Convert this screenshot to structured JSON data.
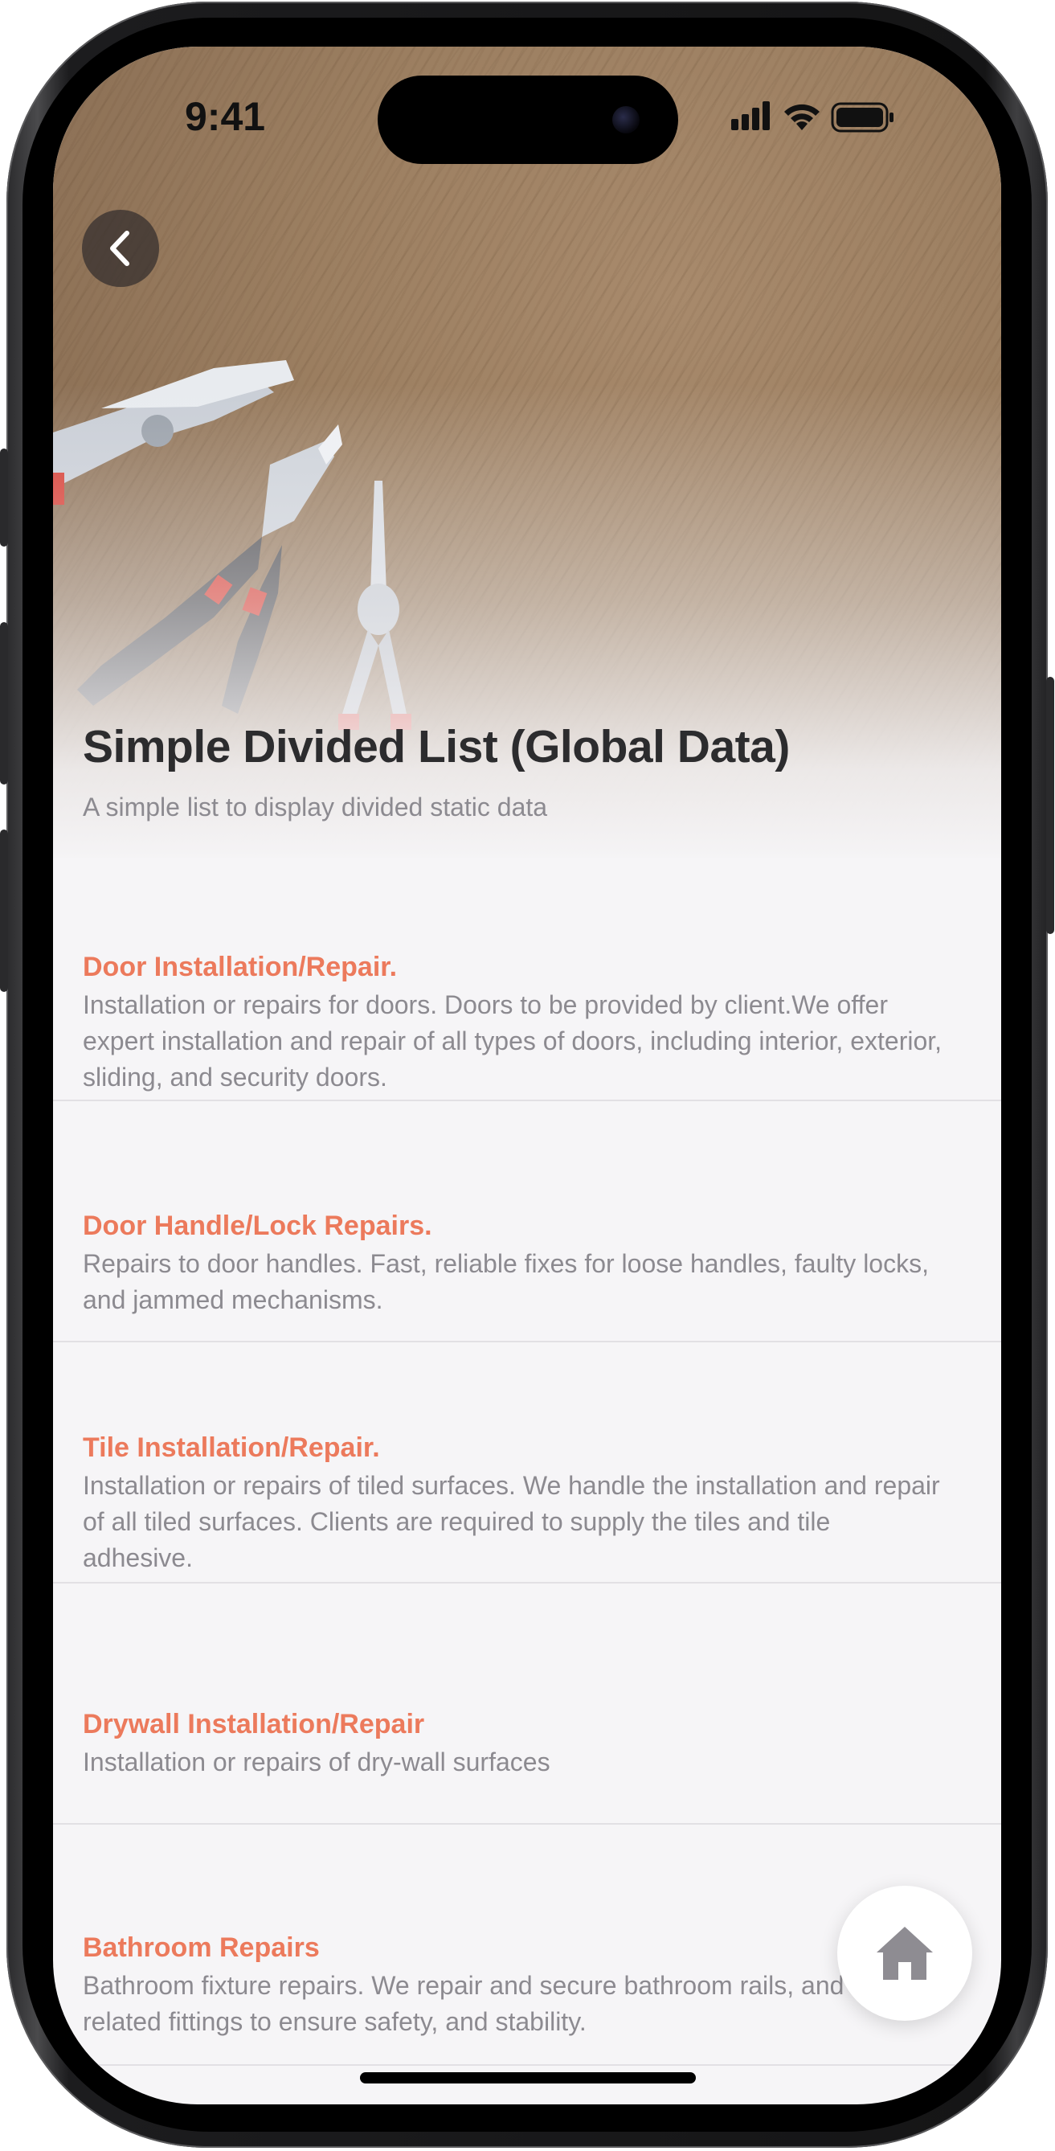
{
  "status_bar": {
    "time": "9:41"
  },
  "header": {
    "title": "Simple Divided List (Global Data)",
    "subtitle": "A simple list to display divided static data"
  },
  "items": [
    {
      "title": "Door Installation/Repair.",
      "description": "Installation or repairs for doors. Doors to be provided by client.We offer expert installation and repair of all types of doors, including interior, exterior, sliding, and security doors."
    },
    {
      "title": "Door Handle/Lock Repairs.",
      "description": "Repairs to door handles. Fast, reliable fixes for loose handles, faulty locks, and jammed mechanisms."
    },
    {
      "title": "Tile Installation/Repair.",
      "description": "Installation or repairs of tiled surfaces.  We handle the installation and repair of all tiled surfaces. Clients are required to supply the tiles and tile adhesive."
    },
    {
      "title": "Drywall Installation/Repair",
      "description": "Installation or repairs of dry-wall surfaces"
    },
    {
      "title": "Bathroom Repairs",
      "description": "Bathroom fixture repairs. We repair and secure bathroom rails, and related fittings to ensure safety, and stability."
    }
  ],
  "colors": {
    "accent": "#ec7a5c",
    "text_secondary": "#8c8a90",
    "title": "#2c2c2e",
    "background": "#f6f5f7"
  },
  "icons": {
    "back": "chevron-left-icon",
    "fab": "home-icon"
  }
}
